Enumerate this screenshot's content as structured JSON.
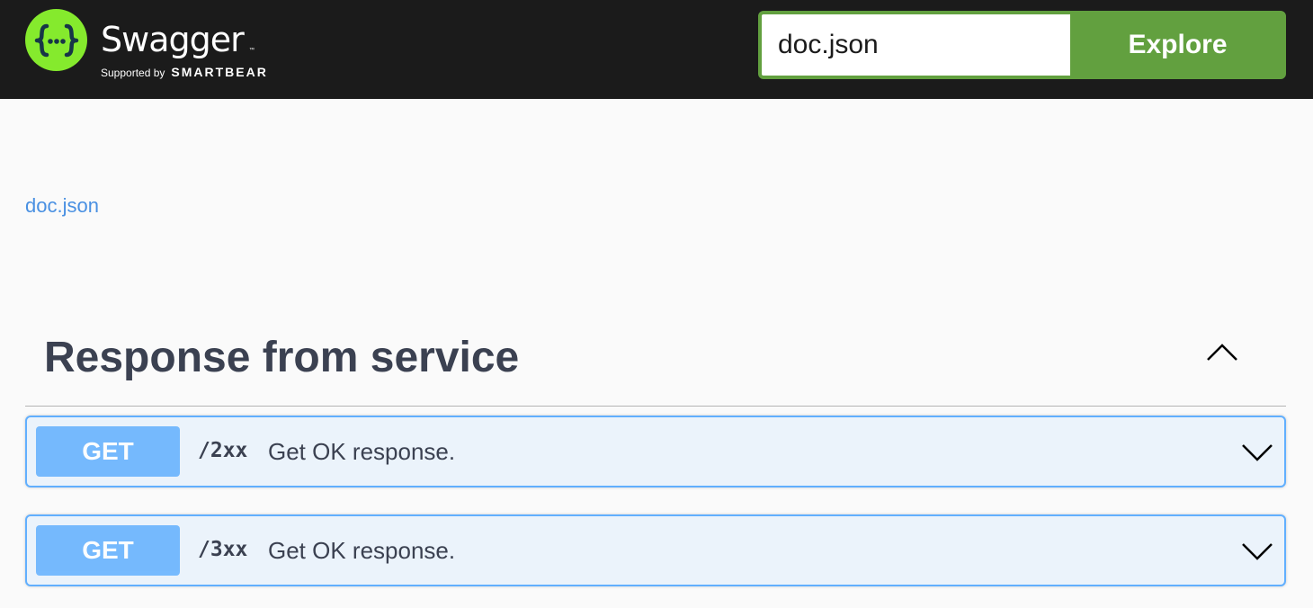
{
  "topbar": {
    "logo": {
      "name": "Swagger",
      "tm": "™",
      "supported_by": "Supported by",
      "brand": "SMARTBEAR",
      "icon": "braces-dots-icon",
      "brand_color": "#85ea2d"
    },
    "url_input": {
      "value": "doc.json",
      "placeholder": ""
    },
    "explore_label": "Explore",
    "explore_color": "#62a03f"
  },
  "info": {
    "link_text": "doc.json"
  },
  "tag": {
    "title": "Response from service",
    "expanded": true,
    "chevron_icon": "chevron-up-icon"
  },
  "operations": [
    {
      "method": "GET",
      "path": "/2xx",
      "summary": "Get OK response.",
      "chevron_icon": "chevron-down-icon"
    },
    {
      "method": "GET",
      "path": "/3xx",
      "summary": "Get OK response.",
      "chevron_icon": "chevron-down-icon"
    }
  ],
  "colors": {
    "get_method": "#61affe",
    "get_background": "#ebf3fb",
    "text": "#3b4151",
    "link": "#4990e2"
  }
}
